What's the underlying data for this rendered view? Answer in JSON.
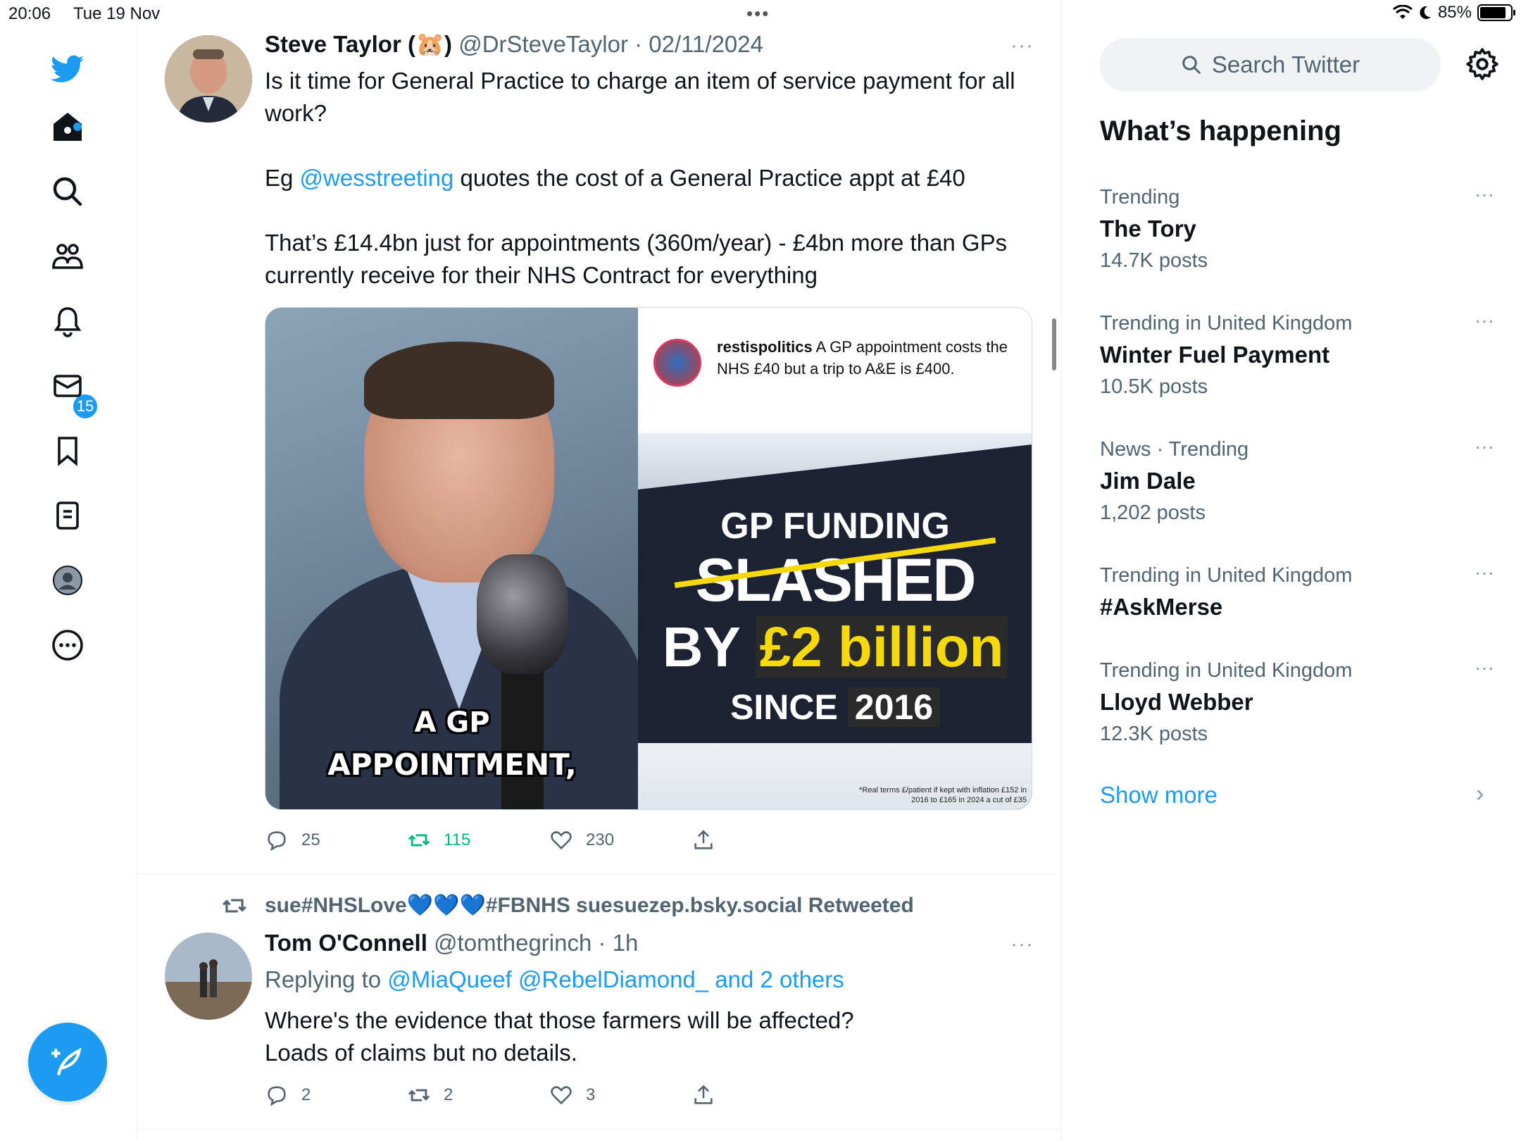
{
  "status_bar": {
    "time": "20:06",
    "date": "Tue 19 Nov",
    "battery": "85%",
    "battery_level": 0.85
  },
  "nav": {
    "notifications_badge": "15",
    "items": [
      "twitter-logo",
      "home-icon",
      "search-icon",
      "communities-icon",
      "notifications-icon",
      "messages-icon",
      "bookmarks-icon",
      "lists-icon",
      "profile-icon",
      "more-icon",
      "compose-icon"
    ]
  },
  "tweet1": {
    "name": "Steve Taylor (🐹)",
    "handle": "@DrSteveTaylor",
    "date": "· 02/11/2024",
    "more": "···",
    "line1": "Is it time for General Practice to charge an item of service payment for all work?",
    "line2_prefix": "Eg ",
    "line2_mention": "@wesstreeting",
    "line2_suffix": " quotes the cost of a General Practice appt at £40",
    "line3": "That’s £14.4bn just for appointments (360m/year) - £4bn more than GPs currently receive for their NHS Contract for everything",
    "media": {
      "caption1": "A GP",
      "caption2": "APPOINTMENT,",
      "ig_user": "restispolitics",
      "ig_text": " A GP appointment costs the NHS £40 but a trip to A&E is £400.",
      "headline1": "GP FUNDING",
      "headline2": "SLASHED",
      "headline3a": "BY ",
      "headline3b": "£2 billion",
      "headline4a": "SINCE ",
      "headline4b": "2016",
      "footnote": "*Real terms £/patient if kept with inflation £152 in 2016 to £165 in 2024 a cut of £35"
    },
    "actions": {
      "replies": "25",
      "retweets": "115",
      "likes": "230"
    }
  },
  "tweet2": {
    "retweeted_by_prefix": "sue#NHSLove",
    "retweeted_by_hearts": "💙💙💙",
    "retweeted_by_suffix": "#FBNHS suesuezep.bsky.social Retweeted",
    "name": "Tom O'Connell",
    "handle": "@tomthegrinch",
    "time": "· 1h",
    "more": "···",
    "replying_prefix": "Replying to ",
    "replying_to": "@MiaQueef @RebelDiamond_ and 2 others",
    "line1": "Where's the evidence that those farmers will be affected?",
    "line2": "Loads of claims but no details.",
    "actions": {
      "replies": "2",
      "retweets": "2",
      "likes": "3"
    }
  },
  "sidebar": {
    "search_placeholder": "Search Twitter",
    "title": "What’s happening",
    "trends": [
      {
        "context": "Trending",
        "name": "The Tory",
        "count": "14.7K posts"
      },
      {
        "context": "Trending in United Kingdom",
        "name": "Winter Fuel Payment",
        "count": "10.5K posts"
      },
      {
        "context": "News · Trending",
        "name": "Jim Dale",
        "count": "1,202 posts"
      },
      {
        "context": "Trending in United Kingdom",
        "name": "#AskMerse",
        "count": ""
      },
      {
        "context": "Trending in United Kingdom",
        "name": "Lloyd Webber",
        "count": "12.3K posts"
      }
    ],
    "trend_more": "···",
    "show_more": "Show more"
  },
  "colors": {
    "accent": "#1d9bf0",
    "retweet_green": "#00ba7c",
    "muted": "#536471"
  }
}
